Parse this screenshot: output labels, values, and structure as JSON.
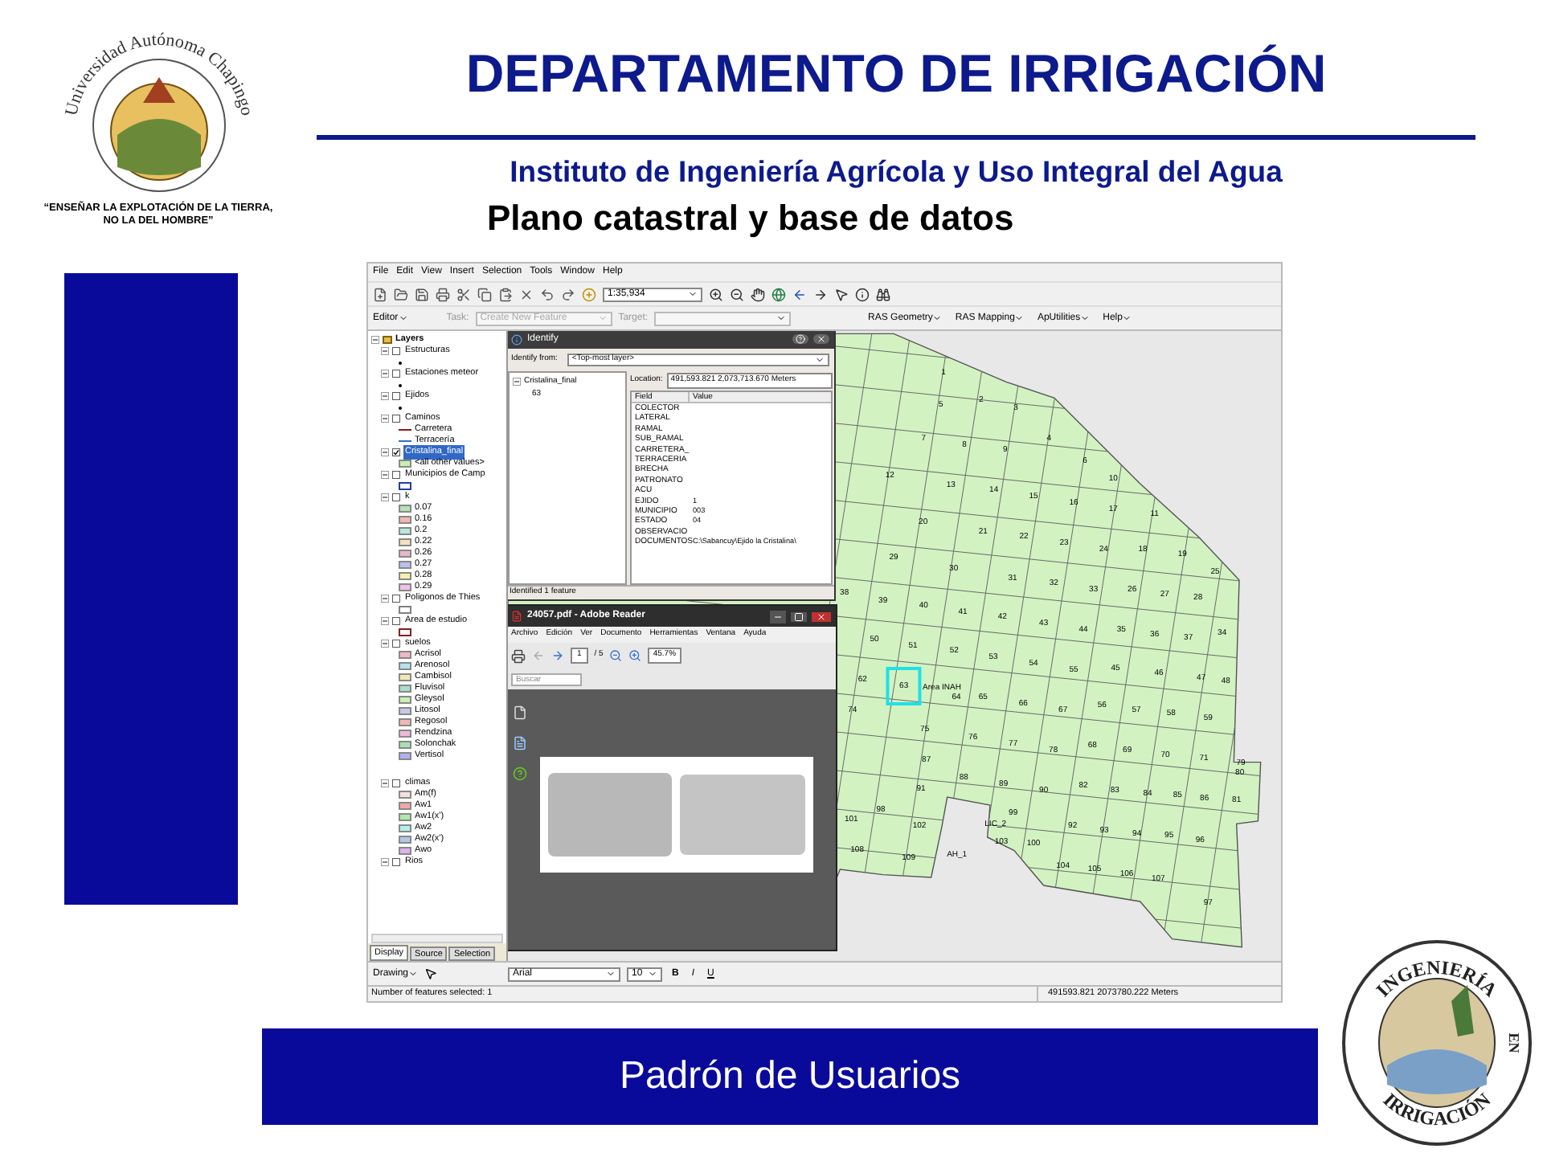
{
  "slide": {
    "title": "DEPARTAMENTO DE IRRIGACIÓN",
    "subtitle": "Instituto de Ingeniería Agrícola y Uso Integral del Agua",
    "heading": "Plano catastral y base de datos",
    "banner": "Padrón de Usuarios"
  },
  "logo_left": {
    "name": "Universidad Autónoma Chapingo",
    "motto": [
      "“ENSEÑAR LA EXPLOTACIÓN DE LA TIERRA,",
      "NO LA DEL HOMBRE”"
    ]
  },
  "logo_right": {
    "top": "INGENIERÍA",
    "middle": "EN",
    "bottom": "IRRIGACIÓN"
  },
  "gis": {
    "menu": [
      "File",
      "Edit",
      "View",
      "Insert",
      "Selection",
      "Tools",
      "Window",
      "Help"
    ],
    "scale": "1:35,934",
    "editor": "Editor",
    "task_label": "Task:",
    "task": "Create New Feature",
    "target_label": "Target:",
    "toolbar_menus": [
      "RAS Geometry",
      "RAS Mapping",
      "ApUtilities",
      "Help"
    ],
    "layers_root": "Layers",
    "layers": [
      {
        "name": "Estructuras",
        "checked": false,
        "selected": false,
        "expanded": true,
        "children": [
          {
            "kind": "point"
          }
        ]
      },
      {
        "name": "Estaciones meteor",
        "checked": false,
        "selected": false,
        "expanded": true,
        "children": [
          {
            "kind": "point"
          }
        ]
      },
      {
        "name": "Ejidos",
        "checked": false,
        "selected": false,
        "expanded": true,
        "children": [
          {
            "kind": "point"
          }
        ]
      },
      {
        "name": "Caminos",
        "checked": false,
        "selected": false,
        "expanded": true,
        "children": [
          {
            "kind": "line",
            "label": "Carretera",
            "color": "#8b1a1a"
          },
          {
            "kind": "line",
            "label": "Terracería",
            "color": "#3070c0"
          }
        ]
      },
      {
        "name": "Cristalina_final",
        "checked": true,
        "selected": true,
        "expanded": true,
        "children": [
          {
            "kind": "swatch",
            "label": "<all other values>",
            "color": "#c8f0b0"
          }
        ]
      },
      {
        "name": "Municipios de Camp",
        "checked": false,
        "selected": false,
        "expanded": true,
        "children": [
          {
            "kind": "outline",
            "color": "#2040a0"
          }
        ]
      },
      {
        "name": "k",
        "checked": false,
        "selected": false,
        "expanded": true,
        "children": [
          {
            "kind": "swatch",
            "label": "0.07",
            "color": "#b5e3b5"
          },
          {
            "kind": "swatch",
            "label": "0.16",
            "color": "#f0b8b0"
          },
          {
            "kind": "swatch",
            "label": "0.2",
            "color": "#b8e8e0"
          },
          {
            "kind": "swatch",
            "label": "0.22",
            "color": "#f5e0c0"
          },
          {
            "kind": "swatch",
            "label": "0.26",
            "color": "#e8b8c8"
          },
          {
            "kind": "swatch",
            "label": "0.27",
            "color": "#b8c0f0"
          },
          {
            "kind": "swatch",
            "label": "0.28",
            "color": "#f5f0b0"
          },
          {
            "kind": "swatch",
            "label": "0.29",
            "color": "#f0c0e8"
          }
        ]
      },
      {
        "name": "Poligonos de Thies",
        "checked": false,
        "selected": false,
        "expanded": true,
        "children": [
          {
            "kind": "outline",
            "color": "#808080"
          }
        ]
      },
      {
        "name": "Area de estudio",
        "checked": false,
        "selected": false,
        "expanded": true,
        "children": [
          {
            "kind": "outline",
            "color": "#802020"
          }
        ]
      },
      {
        "name": "suelos",
        "checked": false,
        "selected": false,
        "expanded": true,
        "children": [
          {
            "kind": "swatch",
            "label": "Acrisol",
            "color": "#f0b8c8"
          },
          {
            "kind": "swatch",
            "label": "Arenosol",
            "color": "#b8e0f0"
          },
          {
            "kind": "swatch",
            "label": "Cambisol",
            "color": "#f0e8b0"
          },
          {
            "kind": "swatch",
            "label": "Fluvisol",
            "color": "#a8e0c8"
          },
          {
            "kind": "swatch",
            "label": "Gleysol",
            "color": "#c8f0b0"
          },
          {
            "kind": "swatch",
            "label": "Litosol",
            "color": "#c8c8e8"
          },
          {
            "kind": "swatch",
            "label": "Regosol",
            "color": "#f0b8b8"
          },
          {
            "kind": "swatch",
            "label": "Rendzina",
            "color": "#f0b8d8"
          },
          {
            "kind": "swatch",
            "label": "Solonchak",
            "color": "#a8e0b0"
          },
          {
            "kind": "swatch",
            "label": "Vertisol",
            "color": "#b0b0f0"
          }
        ]
      },
      {
        "name": "climas",
        "checked": false,
        "selected": false,
        "expanded": true,
        "children": [
          {
            "kind": "swatch",
            "label": "Am(f)",
            "color": "#f5e0e0"
          },
          {
            "kind": "swatch",
            "label": "Aw1",
            "color": "#f0a8a8"
          },
          {
            "kind": "swatch",
            "label": "Aw1(x')",
            "color": "#b0e8a8"
          },
          {
            "kind": "swatch",
            "label": "Aw2",
            "color": "#b0f0e8"
          },
          {
            "kind": "swatch",
            "label": "Aw2(x')",
            "color": "#b0c8e8"
          },
          {
            "kind": "swatch",
            "label": "Awo",
            "color": "#e0b0f0"
          }
        ]
      },
      {
        "name": "Rios",
        "checked": false,
        "selected": false,
        "expanded": true
      }
    ],
    "panel_tabs": [
      {
        "label": "Display",
        "selected": true
      },
      {
        "label": "Source",
        "selected": false
      },
      {
        "label": "Selection",
        "selected": false
      }
    ],
    "drawing": "Drawing",
    "font": "Arial",
    "font_size": "10",
    "format_buttons": [
      "B",
      "I",
      "U"
    ],
    "status_left": "Number of features selected: 1",
    "status_right": "491593.821  2073780.222 Meters",
    "parcels": [
      {
        "label": "1",
        "selected": false
      },
      {
        "label": "2",
        "selected": false
      },
      {
        "label": "5",
        "selected": false
      },
      {
        "label": "3",
        "selected": false
      },
      {
        "label": "7",
        "selected": false
      },
      {
        "label": "4",
        "selected": false
      },
      {
        "label": "8",
        "selected": false
      },
      {
        "label": "9",
        "selected": false
      },
      {
        "label": "6",
        "selected": false
      },
      {
        "label": "12",
        "selected": false
      },
      {
        "label": "10",
        "selected": false
      },
      {
        "label": "13",
        "selected": false
      },
      {
        "label": "14",
        "selected": false
      },
      {
        "label": "15",
        "selected": false
      },
      {
        "label": "16",
        "selected": false
      },
      {
        "label": "17",
        "selected": false
      },
      {
        "label": "11",
        "selected": false
      },
      {
        "label": "20",
        "selected": false
      },
      {
        "label": "21",
        "selected": false
      },
      {
        "label": "22",
        "selected": false
      },
      {
        "label": "23",
        "selected": false
      },
      {
        "label": "29",
        "selected": false
      },
      {
        "label": "24",
        "selected": false
      },
      {
        "label": "18",
        "selected": false
      },
      {
        "label": "19",
        "selected": false
      },
      {
        "label": "30",
        "selected": false
      },
      {
        "label": "25",
        "selected": false
      },
      {
        "label": "31",
        "selected": false
      },
      {
        "label": "32",
        "selected": false
      },
      {
        "label": "38",
        "selected": false
      },
      {
        "label": "39",
        "selected": false
      },
      {
        "label": "33",
        "selected": false
      },
      {
        "label": "26",
        "selected": false
      },
      {
        "label": "27",
        "selected": false
      },
      {
        "label": "28",
        "selected": false
      },
      {
        "label": "40",
        "selected": false
      },
      {
        "label": "41",
        "selected": false
      },
      {
        "label": "42",
        "selected": false
      },
      {
        "label": "43",
        "selected": false
      },
      {
        "label": "50",
        "selected": false
      },
      {
        "label": "44",
        "selected": false
      },
      {
        "label": "35",
        "selected": false
      },
      {
        "label": "36",
        "selected": false
      },
      {
        "label": "37",
        "selected": false
      },
      {
        "label": "34",
        "selected": false
      },
      {
        "label": "51",
        "selected": false
      },
      {
        "label": "52",
        "selected": false
      },
      {
        "label": "53",
        "selected": false
      },
      {
        "label": "54",
        "selected": false
      },
      {
        "label": "55",
        "selected": false
      },
      {
        "label": "45",
        "selected": false
      },
      {
        "label": "46",
        "selected": false
      },
      {
        "label": "62",
        "selected": false
      },
      {
        "label": "63",
        "selected": true
      },
      {
        "label": "Area INAH",
        "selected": false
      },
      {
        "label": "47",
        "selected": false
      },
      {
        "label": "48",
        "selected": false
      },
      {
        "label": "64",
        "selected": false
      },
      {
        "label": "65",
        "selected": false
      },
      {
        "label": "74",
        "selected": false
      },
      {
        "label": "66",
        "selected": false
      },
      {
        "label": "67",
        "selected": false
      },
      {
        "label": "56",
        "selected": false
      },
      {
        "label": "57",
        "selected": false
      },
      {
        "label": "58",
        "selected": false
      },
      {
        "label": "59",
        "selected": false
      },
      {
        "label": "75",
        "selected": false
      },
      {
        "label": "76",
        "selected": false
      },
      {
        "label": "77",
        "selected": false
      },
      {
        "label": "68",
        "selected": false
      },
      {
        "label": "87",
        "selected": false
      },
      {
        "label": "78",
        "selected": false
      },
      {
        "label": "69",
        "selected": false
      },
      {
        "label": "70",
        "selected": false
      },
      {
        "label": "71",
        "selected": false
      },
      {
        "label": "79",
        "selected": false
      },
      {
        "label": "88",
        "selected": false
      },
      {
        "label": "80",
        "selected": false
      },
      {
        "label": "91",
        "selected": false
      },
      {
        "label": "89",
        "selected": false
      },
      {
        "label": "90",
        "selected": false
      },
      {
        "label": "82",
        "selected": false
      },
      {
        "label": "83",
        "selected": false
      },
      {
        "label": "84",
        "selected": false
      },
      {
        "label": "85",
        "selected": false
      },
      {
        "label": "86",
        "selected": false
      },
      {
        "label": "81",
        "selected": false
      },
      {
        "label": "98",
        "selected": false
      },
      {
        "label": "99",
        "selected": false
      },
      {
        "label": "101",
        "selected": false
      },
      {
        "label": "102",
        "selected": false
      },
      {
        "label": "LIC_2",
        "selected": false
      },
      {
        "label": "103",
        "selected": false
      },
      {
        "label": "100",
        "selected": false
      },
      {
        "label": "92",
        "selected": false
      },
      {
        "label": "93",
        "selected": false
      },
      {
        "label": "94",
        "selected": false
      },
      {
        "label": "95",
        "selected": false
      },
      {
        "label": "96",
        "selected": false
      },
      {
        "label": "108",
        "selected": false
      },
      {
        "label": "109",
        "selected": false
      },
      {
        "label": "AH_1",
        "selected": false
      },
      {
        "label": "104",
        "selected": false
      },
      {
        "label": "105",
        "selected": false
      },
      {
        "label": "106",
        "selected": false
      },
      {
        "label": "107",
        "selected": false
      },
      {
        "label": "97",
        "selected": false
      }
    ]
  },
  "identify": {
    "title": "Identify",
    "from_label": "Identify from:",
    "from": "<Top-most layer>",
    "layer": "Cristalina_final",
    "feature": "63",
    "location_label": "Location:",
    "location": "491,593.821  2,073,713.670 Meters",
    "columns": [
      "Field",
      "Value"
    ],
    "rows": [
      {
        "field": "COLECTOR",
        "value": ""
      },
      {
        "field": "LATERAL",
        "value": ""
      },
      {
        "field": "RAMAL",
        "value": ""
      },
      {
        "field": "SUB_RAMAL",
        "value": ""
      },
      {
        "field": "CARRETERA_",
        "value": ""
      },
      {
        "field": "TERRACERIA",
        "value": ""
      },
      {
        "field": "BRECHA",
        "value": ""
      },
      {
        "field": "PATRONATO",
        "value": ""
      },
      {
        "field": "ACU",
        "value": ""
      },
      {
        "field": "EJIDO",
        "value": "1"
      },
      {
        "field": "MUNICIPIO",
        "value": "003"
      },
      {
        "field": "ESTADO",
        "value": "04"
      },
      {
        "field": "OBSERVACIO",
        "value": ""
      },
      {
        "field": "DOCUMENTOS",
        "value": "C:\\Sabancuy\\Ejido la Cristalina\\"
      }
    ],
    "status": "Identified 1 feature"
  },
  "reader": {
    "title": "24057.pdf - Adobe Reader",
    "menu": [
      "Archivo",
      "Edición",
      "Ver",
      "Documento",
      "Herramientas",
      "Ventana",
      "Ayuda"
    ],
    "page": "1",
    "pages": "/ 5",
    "zoom": "45.7%",
    "search_placeholder": "Buscar"
  }
}
